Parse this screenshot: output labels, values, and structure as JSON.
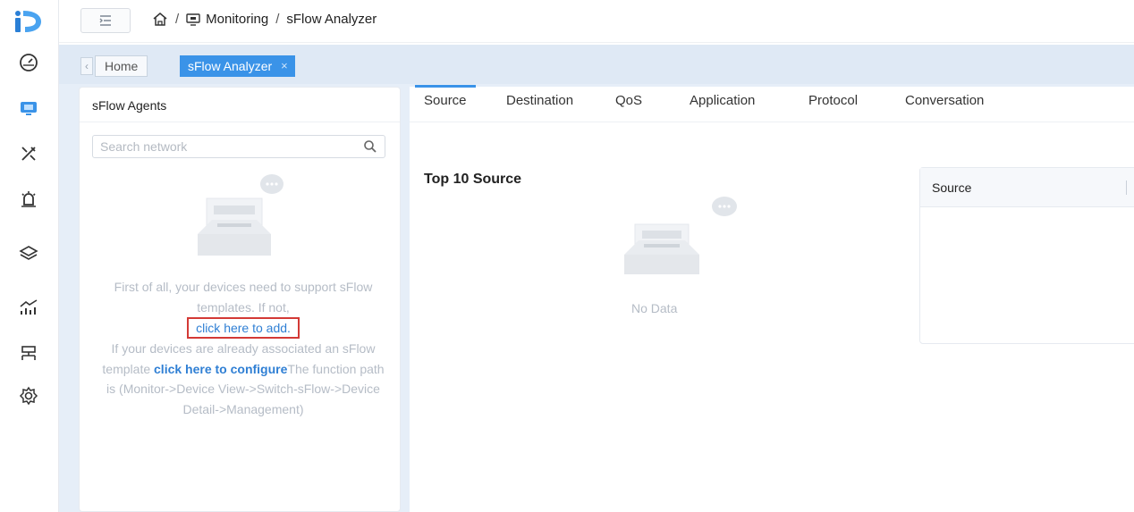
{
  "header": {
    "breadcrumb": [
      "Monitoring",
      "sFlow Analyzer"
    ],
    "breadcrumb_separator": "/"
  },
  "page_tabs": {
    "home_label": "Home",
    "active_label": "sFlow Analyzer",
    "close_glyph": "×"
  },
  "agents_panel": {
    "title": "sFlow Agents",
    "search_placeholder": "Search network",
    "help_line1": "First of all, your devices need to support sFlow templates. If not,",
    "add_link": "click here to add.",
    "help_line2": "If your devices are already associated an sFlow template",
    "configure_link": "click here to configure",
    "help_line3": "The function path is (Monitor->Device View->Switch-sFlow->Device Detail->Management)"
  },
  "main_tabs": [
    "Source",
    "Destination",
    "QoS",
    "Application",
    "Protocol",
    "Conversation"
  ],
  "main_tabs_active": 0,
  "section": {
    "title": "Top 10 Source",
    "empty_text": "No Data",
    "table_header": "Source"
  },
  "rail_icons": [
    "dashboard-icon",
    "monitoring-icon",
    "tools-icon",
    "alarm-icon",
    "layers-icon",
    "analytics-icon",
    "topology-icon",
    "settings-icon"
  ],
  "colors": {
    "accent": "#3a93e8",
    "tabbar_bg": "#dfe9f5",
    "content_bg": "#e6eef8",
    "link": "#2f7fd4",
    "highlight_box": "#d33a36"
  }
}
